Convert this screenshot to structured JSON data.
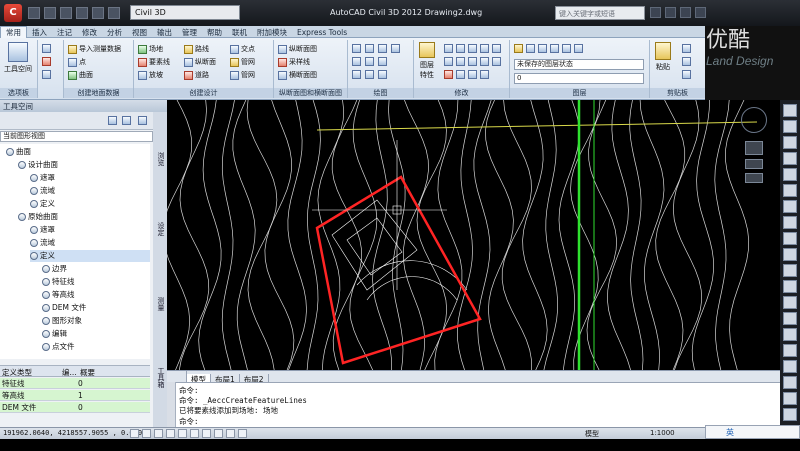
{
  "title_bar": {
    "app_logo": "C",
    "workspace": "Civil 3D",
    "title": "AutoCAD Civil 3D 2012    Drawing2.dwg",
    "search_placeholder": "键入关键字或短语"
  },
  "ribbon_tabs": [
    "常用",
    "插入",
    "注记",
    "修改",
    "分析",
    "视图",
    "输出",
    "管理",
    "帮助",
    "联机",
    "附加模块",
    "Express Tools"
  ],
  "ribbon": {
    "panels": {
      "palettes": {
        "title": "选项板",
        "big_button": "工具空间"
      },
      "create_ground": {
        "title": "创建地面数据",
        "items": [
          "导入测量数据",
          "点",
          "曲面"
        ]
      },
      "create_design": {
        "title": "创建设计",
        "items": [
          "场地",
          "要素线",
          "放坡",
          "路线",
          "纵断面",
          "道路",
          "交点",
          "管网",
          "管网"
        ]
      },
      "profile_section": {
        "title": "纵断面图和横断面图",
        "items": [
          "纵断面图",
          "采样线",
          "横断面图"
        ]
      },
      "draw": {
        "title": "绘图"
      },
      "modify": {
        "title": "修改"
      },
      "layers": {
        "title": "图层",
        "layer_state": "未保存的图层状态",
        "current_layer": "0"
      },
      "clipboard": {
        "title": "剪贴板",
        "paste": "粘贴"
      }
    },
    "layer_props_label": "图层特性"
  },
  "watermark": {
    "logo_cn": "优酷",
    "brand": "Land Design"
  },
  "toolspace": {
    "header": "工具空间",
    "view_selector": "当前图形视图",
    "side_tabs": [
      "浏览",
      "设定",
      "测量",
      "工具箱"
    ],
    "tree": [
      {
        "label": "曲面",
        "indent": 1,
        "expanded": true
      },
      {
        "label": "设计曲面",
        "indent": 2,
        "expanded": true
      },
      {
        "label": "遮罩",
        "indent": 3
      },
      {
        "label": "流域",
        "indent": 3
      },
      {
        "label": "定义",
        "indent": 3
      },
      {
        "label": "原始曲面",
        "indent": 2,
        "expanded": true
      },
      {
        "label": "遮罩",
        "indent": 3
      },
      {
        "label": "流域",
        "indent": 3
      },
      {
        "label": "定义",
        "indent": 3,
        "selected": true
      },
      {
        "label": "边界",
        "indent": 4
      },
      {
        "label": "特征线",
        "indent": 4
      },
      {
        "label": "等高线",
        "indent": 4
      },
      {
        "label": "DEM 文件",
        "indent": 4
      },
      {
        "label": "图形对象",
        "indent": 4
      },
      {
        "label": "编辑",
        "indent": 4
      },
      {
        "label": "点文件",
        "indent": 4
      }
    ],
    "table": {
      "headers": [
        "定义类型",
        "编...",
        "概要"
      ],
      "rows": [
        {
          "type": "特征线",
          "count": "0"
        },
        {
          "type": "等高线",
          "count": "1"
        },
        {
          "type": "DEM 文件",
          "count": "0"
        }
      ]
    }
  },
  "layout_tabs": [
    "模型",
    "布局1",
    "布局2"
  ],
  "command_lines": [
    "命令:",
    "命令: _AeccCreateFeatureLines",
    "已将要素线添加到场地: 场地",
    "命令:"
  ],
  "status_bar": {
    "coords": "191962.0640, 4218557.9055 , 0.0000",
    "model_label": "模型",
    "scale": "1:1000",
    "ime": "英"
  }
}
